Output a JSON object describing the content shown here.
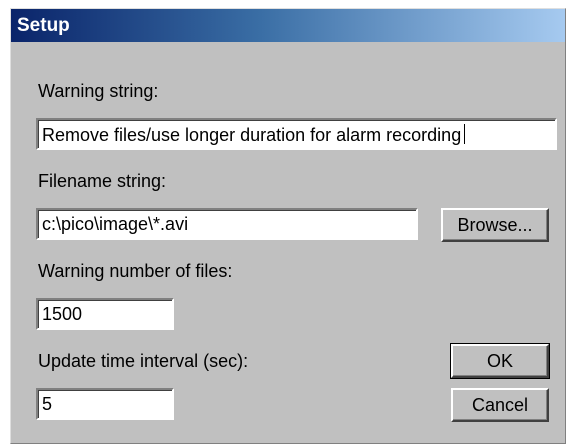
{
  "window": {
    "title": "Setup"
  },
  "warning_string": {
    "label": "Warning string:",
    "value": "Remove files/use longer duration for alarm recording"
  },
  "filename_string": {
    "label": "Filename string:",
    "value": "c:\\pico\\image\\*.avi",
    "browse_label": "Browse..."
  },
  "warning_number": {
    "label": "Warning number of files:",
    "value": "1500"
  },
  "update_interval": {
    "label": "Update time interval (sec):",
    "value": "5"
  },
  "buttons": {
    "ok": "OK",
    "cancel": "Cancel"
  }
}
